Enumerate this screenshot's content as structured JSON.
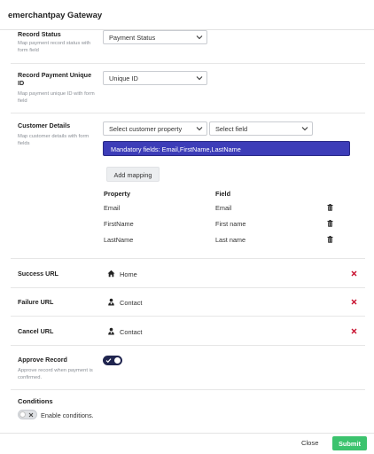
{
  "dialog": {
    "title": "emerchantpay Gateway"
  },
  "record_status": {
    "label": "Record Status",
    "description": "Map payment record status with form field",
    "value": "Payment Status"
  },
  "record_payment_uid": {
    "label": "Record Payment Unique ID",
    "description": "Map payment unique ID with form field",
    "value": "Unique ID"
  },
  "customer_details": {
    "label": "Customer Details",
    "description": "Map customer details with form fields",
    "property_select": "Select customer property",
    "field_select": "Select field",
    "mandatory_notice": "Mandatory fields: Email,FirstName,LastName",
    "add_mapping_label": "Add mapping",
    "columns": {
      "property": "Property",
      "field": "Field"
    },
    "mappings": [
      {
        "property": "Email",
        "field": "Email"
      },
      {
        "property": "FirstName",
        "field": "First name"
      },
      {
        "property": "LastName",
        "field": "Last name"
      }
    ]
  },
  "urls": {
    "success": {
      "label": "Success URL",
      "value": "Home",
      "icon": "home-icon"
    },
    "failure": {
      "label": "Failure URL",
      "value": "Contact",
      "icon": "contact-icon"
    },
    "cancel": {
      "label": "Cancel URL",
      "value": "Contact",
      "icon": "contact-icon"
    }
  },
  "approve_record": {
    "label": "Approve Record",
    "description": "Approve record when payment is confirmed.",
    "enabled": true
  },
  "conditions": {
    "title": "Conditions",
    "toggle_label": "Enable conditions.",
    "enabled": false
  },
  "footer": {
    "close_label": "Close",
    "submit_label": "Submit"
  },
  "colors": {
    "mandatory_bg": "#3d3db8",
    "submit_bg": "#3cc36e",
    "remove_x": "#c8102e",
    "toggle_on": "#20254f"
  }
}
